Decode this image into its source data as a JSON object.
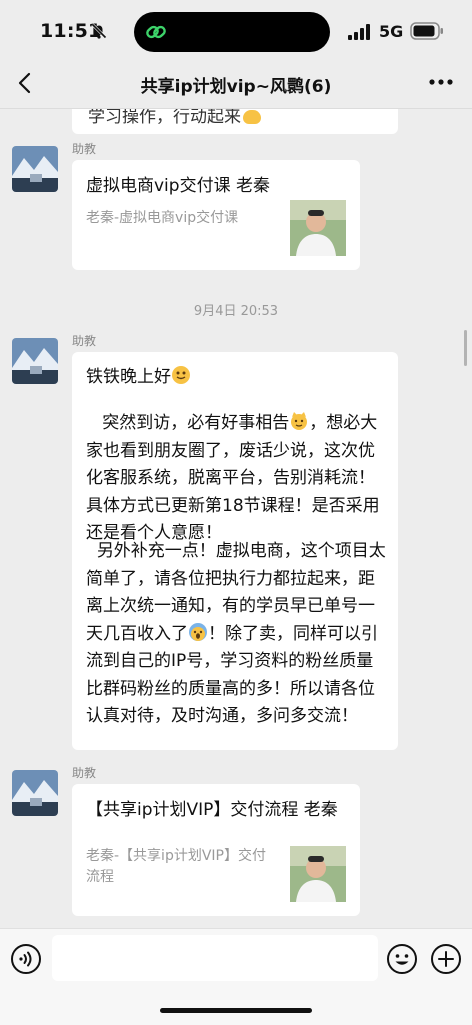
{
  "status": {
    "time": "11:51",
    "network": "5G"
  },
  "header": {
    "title": "共享ip计划vip~风鹮(6)"
  },
  "chat": {
    "prev_fragment": "学习操作，行动起来",
    "messages": [
      {
        "sender": "助教",
        "card_title": "虚拟电商vip交付课 老秦",
        "card_sub": "老秦-虚拟电商vip交付课"
      },
      {
        "timestamp": "9月4日 20:53"
      },
      {
        "sender": "助教",
        "greeting": "铁铁晚上好",
        "para1": "   突然到访，必有好事相告",
        "para1b": "，想必大家也看到朋友圈了，废话少说，这次优化客服系统，脱离平台，告别消耗流！具体方式已更新第18节课程！是否采用还是看个人意愿！",
        "para2": "  另外补充一点！虚拟电商，这个项目太简单了，请各位把执行力都拉起来，距离上次统一通知，有的学员早已单号一天几百收入了",
        "para2b": "！除了卖，同样可以引流到自己的IP号，学习资料的粉丝质量比群码粉丝的质量高的多！所以请各位认真对待，及时沟通，多问多交流！"
      },
      {
        "sender": "助教",
        "card_title": "【共享ip计划VIP】交付流程 老秦",
        "card_sub": "老秦-【共享ip计划VIP】交付流程"
      }
    ]
  },
  "icons": {
    "mute": "bell-slash-icon",
    "back": "chevron-left-icon",
    "more": "ellipsis-icon",
    "voice": "voice-icon",
    "emoji": "smiley-icon",
    "plus": "plus-icon"
  },
  "colors": {
    "background": "#ededed",
    "bubble": "#ffffff",
    "island_accent": "#3dd36a"
  }
}
